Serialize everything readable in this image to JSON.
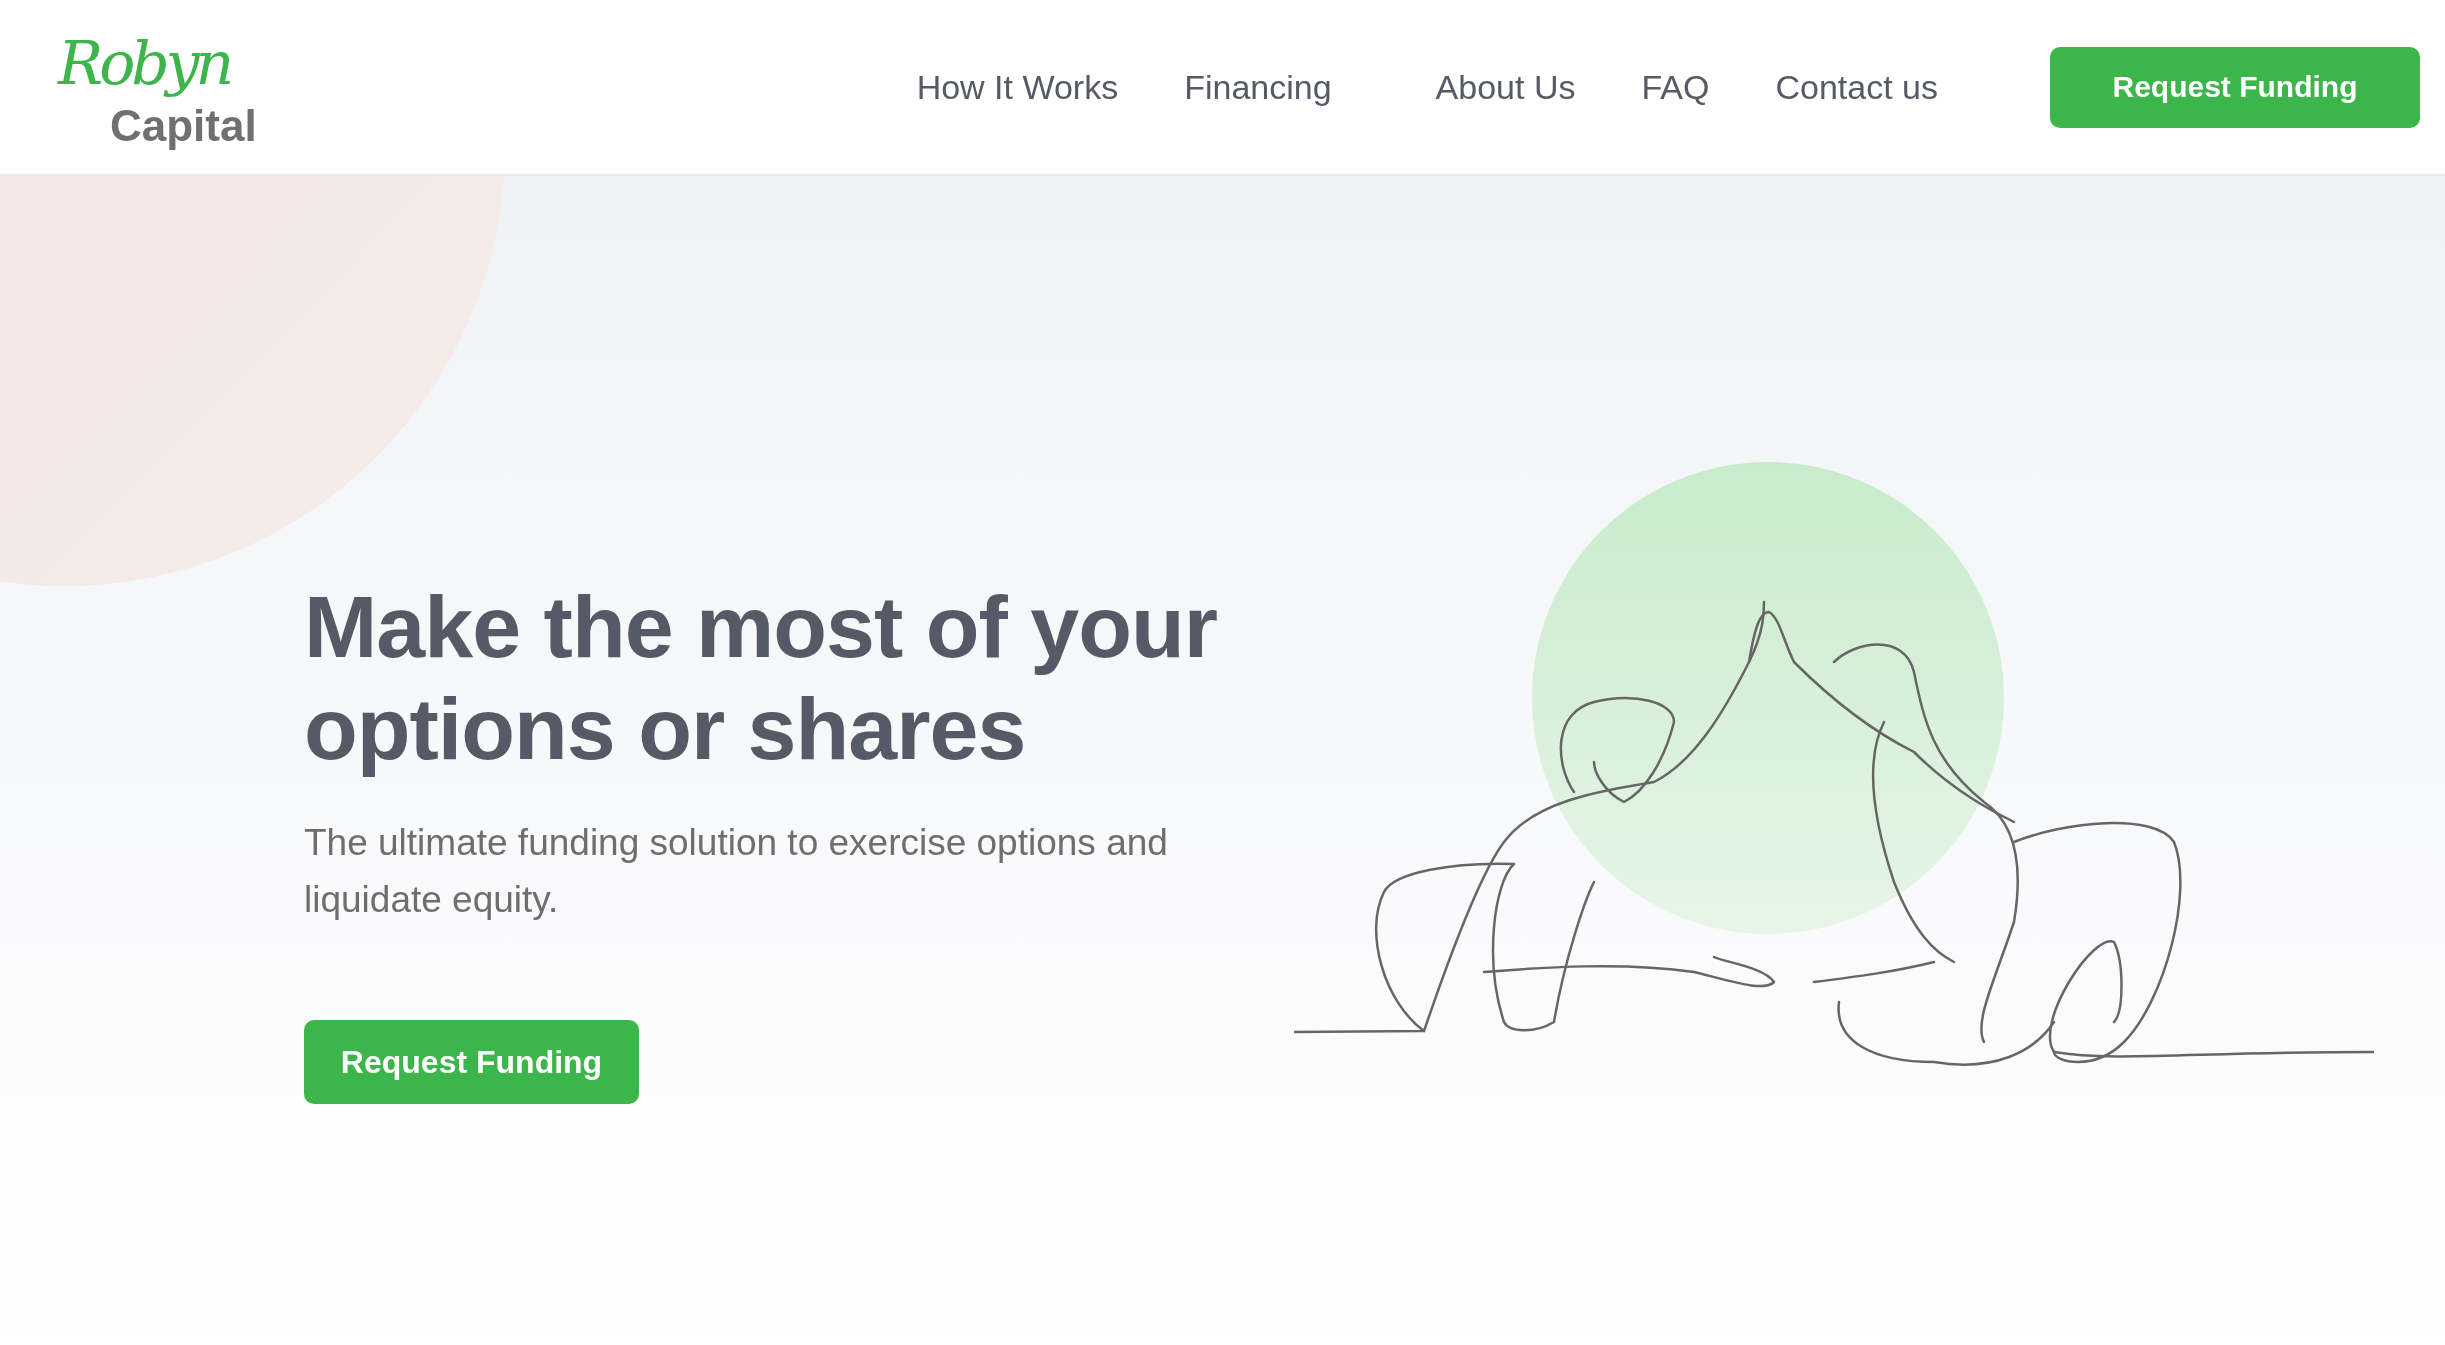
{
  "logo": {
    "script": "Robyn",
    "wordmark": "Capital"
  },
  "nav": {
    "links": [
      "How It Works",
      "Financing",
      "About Us",
      "FAQ",
      "Contact us"
    ],
    "cta": "Request Funding"
  },
  "hero": {
    "headline": "Make the most of your options or shares",
    "subtitle": "The ultimate funding solution to exercise options and liquidate equity.",
    "cta": "Request Funding"
  }
}
